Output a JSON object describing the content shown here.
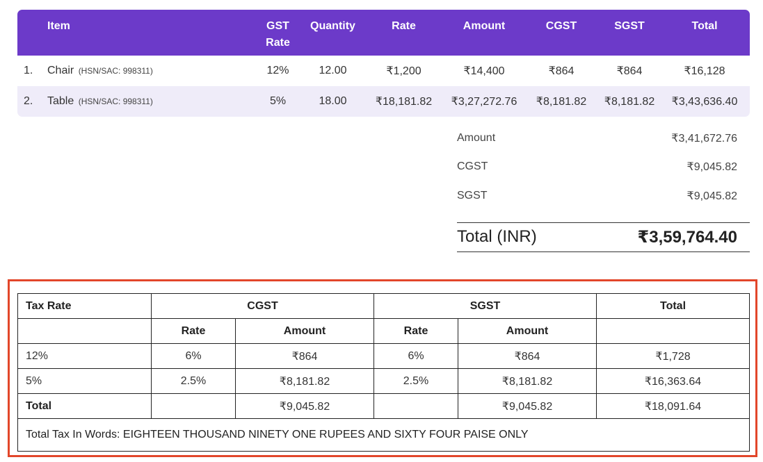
{
  "items_table": {
    "headers": {
      "item": "Item",
      "gst_rate_line1": "GST",
      "gst_rate_line2": "Rate",
      "quantity": "Quantity",
      "rate": "Rate",
      "amount": "Amount",
      "cgst": "CGST",
      "sgst": "SGST",
      "total": "Total"
    },
    "rows": [
      {
        "num": "1.",
        "name": "Chair",
        "hsn": "(HSN/SAC: 998311)",
        "gst_rate": "12%",
        "quantity": "12.00",
        "rate": "₹1,200",
        "amount": "₹14,400",
        "cgst": "₹864",
        "sgst": "₹864",
        "total": "₹16,128"
      },
      {
        "num": "2.",
        "name": "Table",
        "hsn": "(HSN/SAC: 998311)",
        "gst_rate": "5%",
        "quantity": "18.00",
        "rate": "₹18,181.82",
        "amount": "₹3,27,272.76",
        "cgst": "₹8,181.82",
        "sgst": "₹8,181.82",
        "total": "₹3,43,636.40"
      }
    ]
  },
  "summary": {
    "amount_label": "Amount",
    "amount_value": "₹3,41,672.76",
    "cgst_label": "CGST",
    "cgst_value": "₹9,045.82",
    "sgst_label": "SGST",
    "sgst_value": "₹9,045.82",
    "total_label": "Total (INR)",
    "total_value": "₹3,59,764.40"
  },
  "tax_table": {
    "header_tax_rate": "Tax Rate",
    "header_cgst": "CGST",
    "header_sgst": "SGST",
    "header_total": "Total",
    "sub_rate": "Rate",
    "sub_amount": "Amount",
    "rows": [
      {
        "tax_rate": "12%",
        "cgst_rate": "6%",
        "cgst_amount": "₹864",
        "sgst_rate": "6%",
        "sgst_amount": "₹864",
        "total": "₹1,728"
      },
      {
        "tax_rate": "5%",
        "cgst_rate": "2.5%",
        "cgst_amount": "₹8,181.82",
        "sgst_rate": "2.5%",
        "sgst_amount": "₹8,181.82",
        "total": "₹16,363.64"
      }
    ],
    "total_row": {
      "label": "Total",
      "cgst_amount": "₹9,045.82",
      "sgst_amount": "₹9,045.82",
      "total": "₹18,091.64"
    },
    "words": "Total Tax In Words: EIGHTEEN THOUSAND NINETY ONE RUPEES AND SIXTY FOUR PAISE ONLY"
  },
  "colors": {
    "header_bg": "#6c3ac9",
    "alt_row_bg": "#efecf9",
    "highlight_border": "#e2462a"
  }
}
